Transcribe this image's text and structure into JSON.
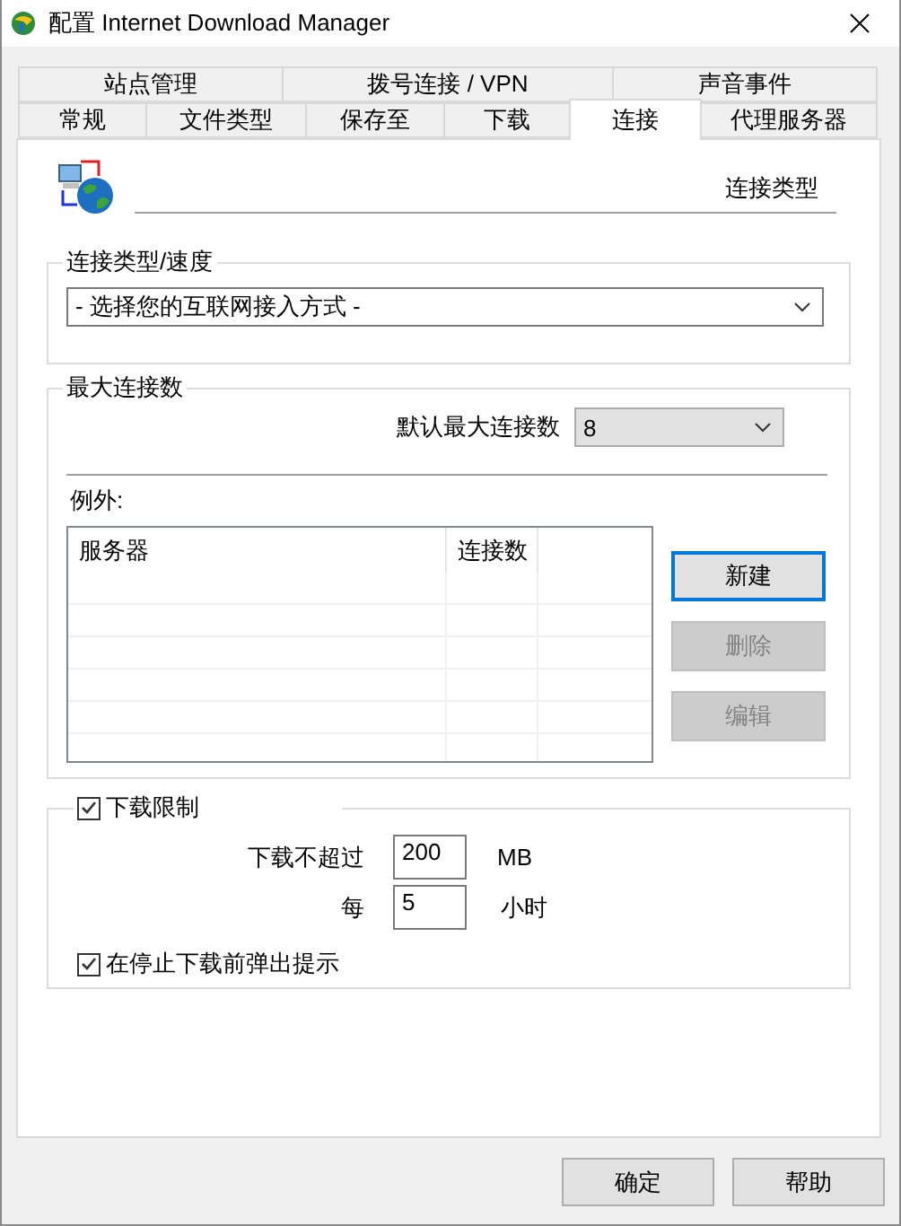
{
  "window": {
    "title": "配置 Internet Download Manager"
  },
  "tab_rows": [
    [
      {
        "label": "站点管理",
        "selected": false
      },
      {
        "label": "拨号连接 / VPN",
        "selected": false
      },
      {
        "label": "声音事件",
        "selected": false
      }
    ],
    [
      {
        "label": "常规",
        "selected": false
      },
      {
        "label": "文件类型",
        "selected": false
      },
      {
        "label": "保存至",
        "selected": false
      },
      {
        "label": "下载",
        "selected": false
      },
      {
        "label": "连接",
        "selected": true
      },
      {
        "label": "代理服务器",
        "selected": false
      }
    ]
  ],
  "page_header": {
    "label": "连接类型"
  },
  "connection_type": {
    "title": "连接类型/速度",
    "value": "- 选择您的互联网接入方式 -"
  },
  "max_connections": {
    "title": "最大连接数",
    "default_label": "默认最大连接数",
    "default_value": "8",
    "exceptions_label": "例外:",
    "table": {
      "columns": [
        "服务器",
        "连接数"
      ]
    },
    "buttons": [
      {
        "label": "新建",
        "disabled": false,
        "focused": true
      },
      {
        "label": "删除",
        "disabled": true,
        "focused": false
      },
      {
        "label": "编辑",
        "disabled": true,
        "focused": false
      }
    ]
  },
  "download_limit": {
    "label": "下载限制",
    "checked": true,
    "limit_label": "下载不超过",
    "limit_value": "200",
    "limit_unit": "MB",
    "per_label": "每",
    "per_value": "5",
    "per_unit": "小时",
    "prompt": {
      "label": "在停止下载前弹出提示",
      "checked": true
    }
  },
  "buttons": [
    {
      "label": "确定"
    },
    {
      "label": "帮助"
    }
  ]
}
